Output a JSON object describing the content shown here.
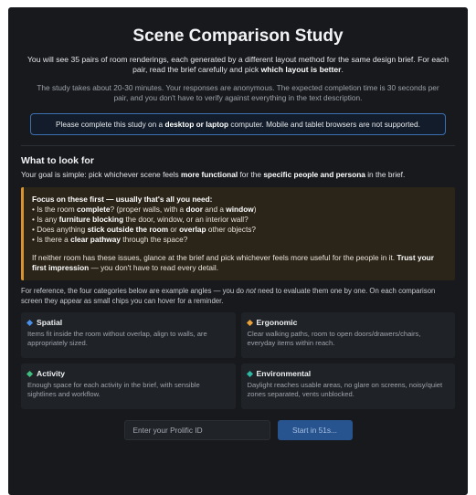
{
  "title": "Scene Comparison Study",
  "intro": {
    "line1_a": "You will see 35 pairs of room renderings, each generated by a different layout method for the same design brief.",
    "line2_a": "For each pair, read the brief carefully and pick ",
    "line2_b": "which layout is better",
    "line2_c": "."
  },
  "intro2": {
    "text": "The study takes about 20-30 minutes. Your responses are anonymous. The expected completion time is 30 seconds per pair, and you don't have to verify against everything in the text description."
  },
  "notice": {
    "a": "Please complete this study on a ",
    "b": "desktop or laptop",
    "c": " computer. Mobile and tablet browsers are not supported."
  },
  "what_to_look_for": {
    "heading": "What to look for",
    "goal_a": "Your goal is simple: pick whichever scene feels ",
    "goal_b": "more functional",
    "goal_c": " for the ",
    "goal_d": "specific people and persona",
    "goal_e": " in the brief."
  },
  "focus": {
    "heading": "Focus on these first — usually that's all you need:",
    "q1": [
      "• Is the room ",
      "complete",
      "? (proper walls, with a ",
      "door",
      " and a ",
      "window",
      ")"
    ],
    "q2": [
      "• Is any ",
      "furniture blocking",
      " the door, window, or an interior wall?"
    ],
    "q3": [
      "• Does anything ",
      "stick outside the room",
      " or ",
      "overlap",
      " other objects?"
    ],
    "q4": [
      "• Is there a ",
      "clear pathway",
      " through the space?"
    ],
    "closing_a": "If neither room has these issues, glance at the brief and pick whichever feels more useful for the people in it. ",
    "closing_b": "Trust your first impression",
    "closing_c": " — you don't have to read every detail."
  },
  "reference": {
    "a": "For reference, the four categories below are example angles — you do ",
    "b": "not",
    "c": " need to evaluate them one by one. On each comparison screen they appear as small chips you can hover for a reminder."
  },
  "categories": [
    {
      "name": "Spatial",
      "color": "#4a8fe7",
      "desc": "Items fit inside the room without overlap, align to walls, are appropriately sized."
    },
    {
      "name": "Ergonomic",
      "color": "#e9a23b",
      "desc": "Clear walking paths, room to open doors/drawers/chairs, everyday items within reach."
    },
    {
      "name": "Activity",
      "color": "#3fbf7f",
      "desc": "Enough space for each activity in the brief, with sensible sightlines and workflow."
    },
    {
      "name": "Environmental",
      "color": "#2fb8a6",
      "desc": "Daylight reaches usable areas, no glare on screens, noisy/quiet zones separated, vents unblocked."
    }
  ],
  "footer": {
    "pid_placeholder": "Enter your Prolific ID",
    "pid_value": "",
    "start_label": "Start in 51s..."
  }
}
